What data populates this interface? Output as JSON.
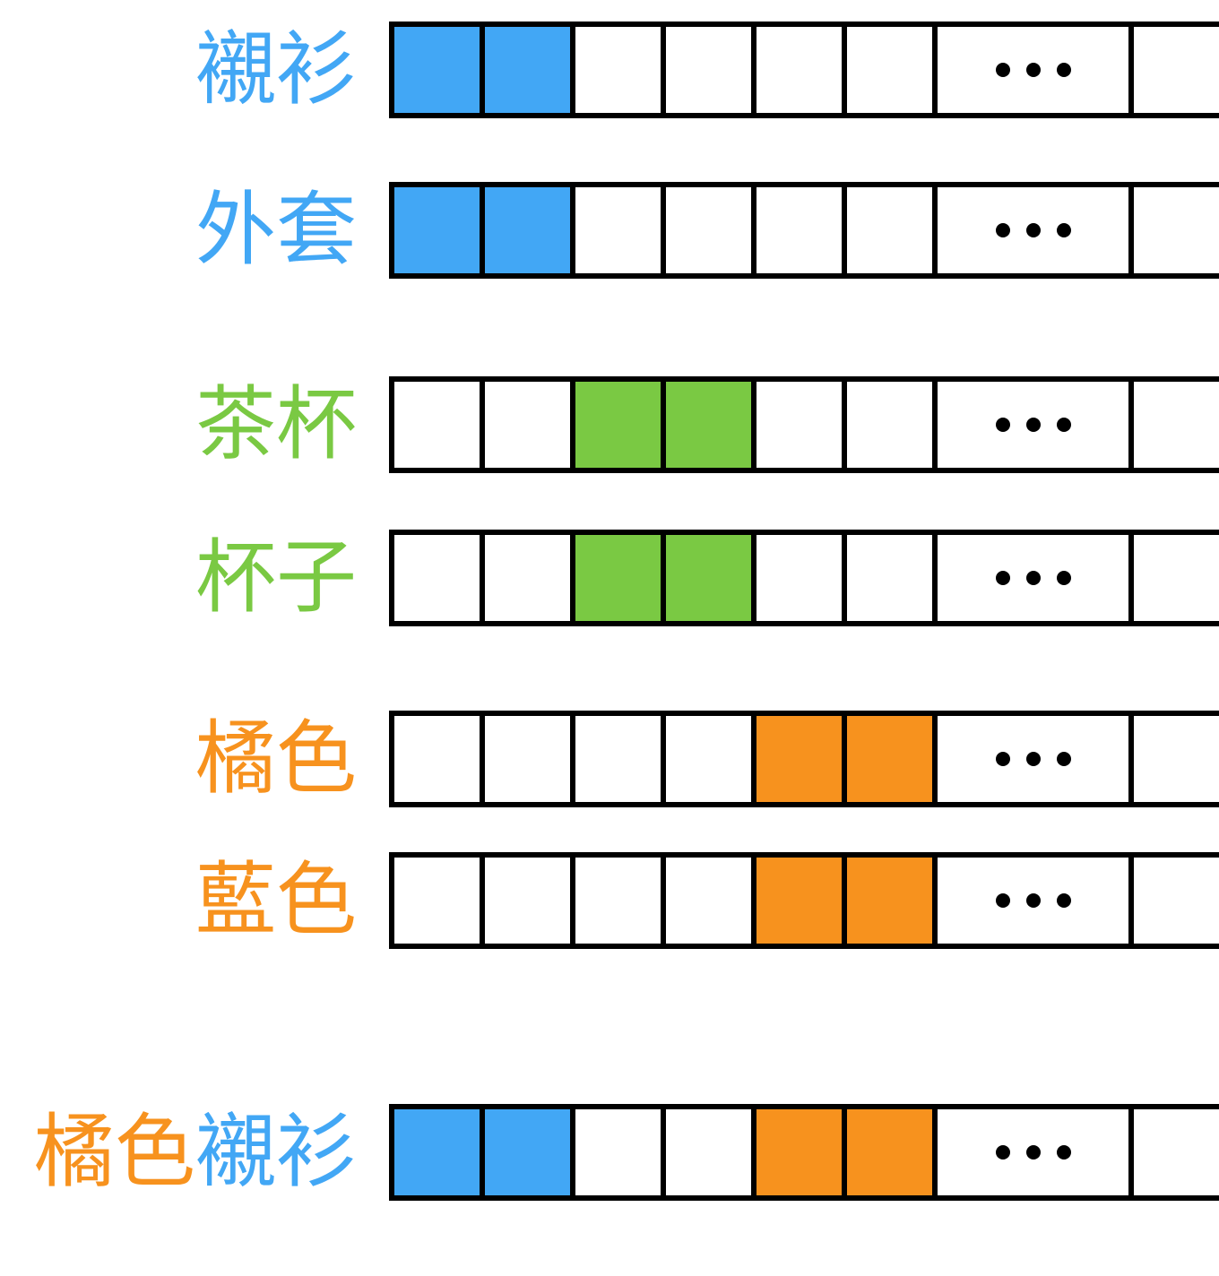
{
  "colors": {
    "blue": "#42a7f5",
    "green": "#7ac943",
    "orange": "#f7921e",
    "empty": "#ffffff",
    "border": "#000000"
  },
  "rows": [
    {
      "label_parts": [
        {
          "text": "襯衫",
          "color": "blue"
        }
      ],
      "cells": [
        "blue",
        "blue",
        "empty",
        "empty",
        "empty",
        "empty"
      ]
    },
    {
      "label_parts": [
        {
          "text": "外套",
          "color": "blue"
        }
      ],
      "cells": [
        "blue",
        "blue",
        "empty",
        "empty",
        "empty",
        "empty"
      ]
    },
    {
      "label_parts": [
        {
          "text": "茶杯",
          "color": "green"
        }
      ],
      "cells": [
        "empty",
        "empty",
        "green",
        "green",
        "empty",
        "empty"
      ]
    },
    {
      "label_parts": [
        {
          "text": "杯子",
          "color": "green"
        }
      ],
      "cells": [
        "empty",
        "empty",
        "green",
        "green",
        "empty",
        "empty"
      ]
    },
    {
      "label_parts": [
        {
          "text": "橘色",
          "color": "orange"
        }
      ],
      "cells": [
        "empty",
        "empty",
        "empty",
        "empty",
        "orange",
        "orange"
      ]
    },
    {
      "label_parts": [
        {
          "text": "藍色",
          "color": "orange"
        }
      ],
      "cells": [
        "empty",
        "empty",
        "empty",
        "empty",
        "orange",
        "orange"
      ]
    },
    {
      "label_parts": [
        {
          "text": "橘色",
          "color": "orange"
        },
        {
          "text": "襯衫",
          "color": "blue"
        }
      ],
      "cells": [
        "blue",
        "blue",
        "empty",
        "empty",
        "orange",
        "orange"
      ]
    }
  ]
}
